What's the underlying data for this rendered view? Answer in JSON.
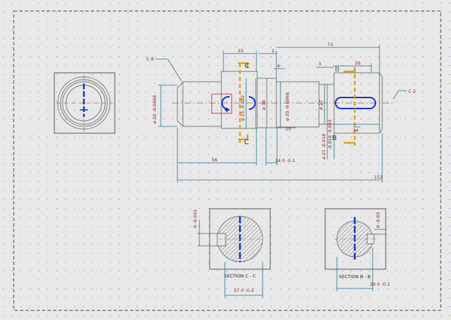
{
  "colors": {
    "background": "#e8e8e8",
    "grid_dots": "#6a78c8",
    "outline": "#777777",
    "dimension": "#1e6f8c",
    "dim_text": "#8b1a1a",
    "keyway": "#1030c8",
    "section_marker": "#d8a21c",
    "view_frame": "#555555",
    "hatch": "#999999"
  },
  "drawing": {
    "chamfer_left": "C 8",
    "chamfer_right": "C 2",
    "section_mark_c": "C",
    "section_mark_b": "B",
    "dims": {
      "d22": "22",
      "d2": "2",
      "d73": "73",
      "d3": "3",
      "d26": "26",
      "d56": "56",
      "d4": "4",
      "d10": "10",
      "d14": "14",
      "d152": "152",
      "dia20_left": "ø 20 -0.0068",
      "dia30": "ø 30",
      "dia25": "ø 25 -0.082",
      "dia20_mid": "ø 20 -0.0068",
      "dia27": "ø 27",
      "tol_right_a": "ø 21 -0.018",
      "tol_right_b": "-0.018 -0.003",
      "tol_mid": "14 0 -0.1",
      "sec_c_depth": "0 -0.035",
      "sec_c_width": "27 0 -0.2",
      "sec_b_depth": "0 -0.03",
      "sec_b_width": "20 0 -0.1"
    },
    "section_c_label": "SECTION C - C",
    "section_b_label": "SECTION B - B"
  }
}
